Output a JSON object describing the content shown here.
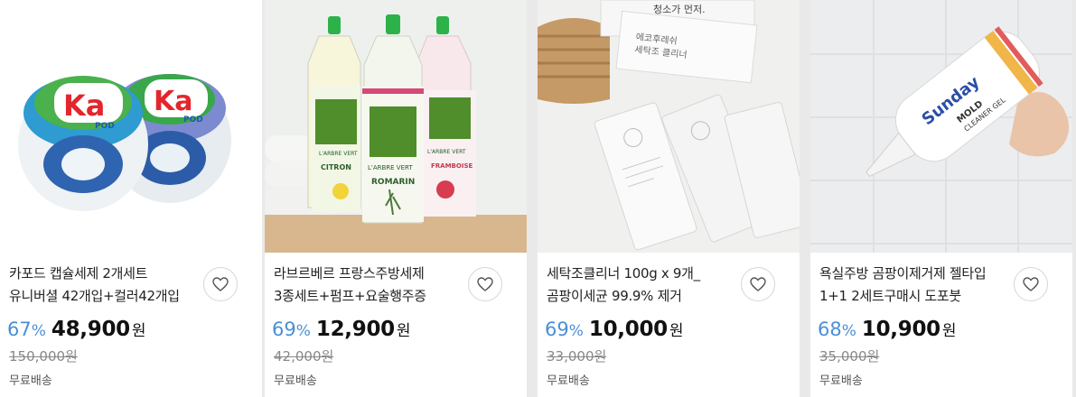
{
  "products": [
    {
      "title": "카포드 캡슐세제 2개세트 유니버셜 42개입+컬러42개입",
      "discount": "67",
      "percent_sign": "%",
      "price": "48,900",
      "currency": "원",
      "original_price": "150,000원",
      "shipping": "무료배송",
      "image": "laundry-capsule-tubs-image",
      "image_text": [
        "Ka",
        "POD",
        "Ka",
        "POD"
      ]
    },
    {
      "title": "라브르베르 프랑스주방세제 3종세트+펌프+요술행주증",
      "discount": "69",
      "percent_sign": "%",
      "price": "12,900",
      "currency": "원",
      "original_price": "42,000원",
      "shipping": "무료배송",
      "image": "dish-soap-bottles-image",
      "image_text": [
        "L'ARBRE VERT",
        "CITRON",
        "L'ARBRE VERT",
        "ROMARIN",
        "L'ARBRE VERT",
        "FRAMBOISE"
      ]
    },
    {
      "title": "세탁조클리너 100g x 9개_곰팡이세균 99.9% 제거",
      "discount": "69",
      "percent_sign": "%",
      "price": "10,000",
      "currency": "원",
      "original_price": "33,000원",
      "shipping": "무료배송",
      "image": "washer-cleaner-packets-image",
      "image_text": [
        "청소가 먼저.",
        "에코후레쉬",
        "세탁조 클리너"
      ]
    },
    {
      "title": "욕실주방 곰팡이제거제 젤타입 1+1 2세트구매시 도포붓",
      "discount": "68",
      "percent_sign": "%",
      "price": "10,900",
      "currency": "원",
      "original_price": "35,000원",
      "shipping": "무료배송",
      "image": "mold-gel-tube-image",
      "image_text": [
        "Sunday",
        "MOLD",
        "CLEANER GEL"
      ]
    }
  ],
  "wishlist_label": "찜하기"
}
